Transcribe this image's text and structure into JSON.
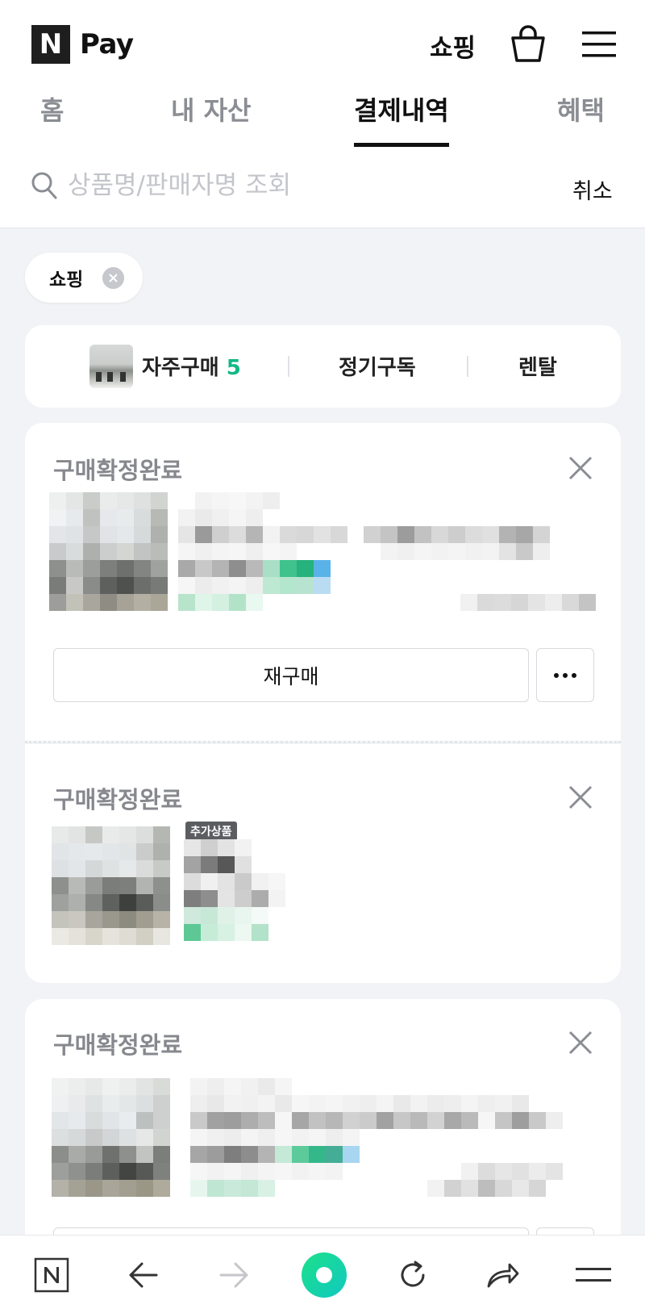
{
  "header": {
    "logo_mark": "N",
    "logo_text": "Pay",
    "shop_label": "쇼핑"
  },
  "tabs": [
    {
      "label": "홈",
      "active": false
    },
    {
      "label": "내 자산",
      "active": false
    },
    {
      "label": "결제내역",
      "active": true
    },
    {
      "label": "혜택",
      "active": false
    }
  ],
  "search": {
    "placeholder": "상품명/판매자명 조회",
    "value": "",
    "cancel_label": "취소"
  },
  "filter_chip": {
    "label": "쇼핑"
  },
  "purchase_filters": {
    "frequent_label": "자주구매",
    "frequent_count": "5",
    "subscription_label": "정기구독",
    "rental_label": "렌탈"
  },
  "orders": [
    {
      "status": "구매확정완료",
      "rebuy_label": "재구매"
    },
    {
      "status": "구매확정완료",
      "extra_badge": "추가상품"
    },
    {
      "status": "구매확정완료"
    }
  ],
  "colors": {
    "accent_green": "#12b886",
    "page_bg": "#f2f3f6",
    "muted_text": "#86888d"
  },
  "bottom_nav": {
    "items": [
      "naver-home-icon",
      "back-arrow-icon",
      "forward-arrow-icon",
      "green-dot-icon",
      "refresh-icon",
      "share-icon",
      "menu-icon"
    ]
  }
}
